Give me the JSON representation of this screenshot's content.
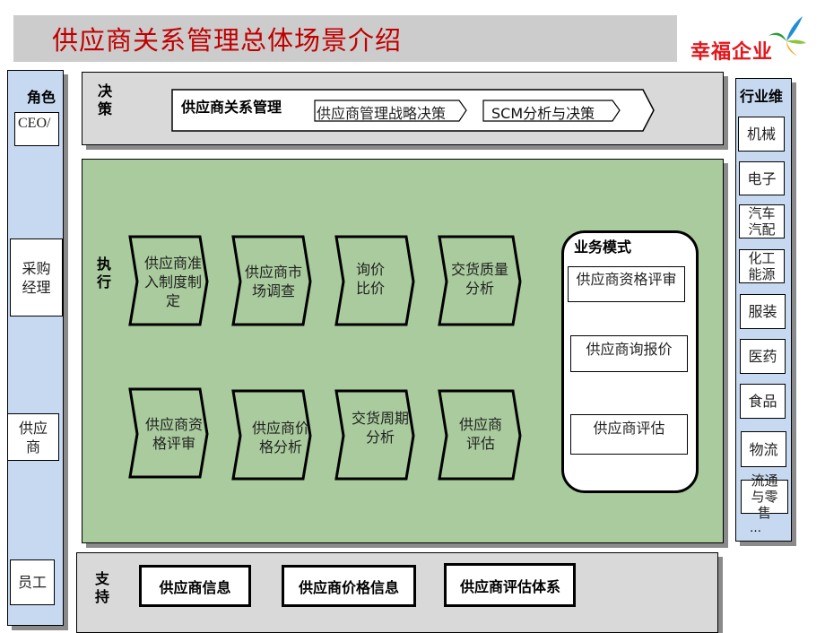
{
  "header": {
    "title": "供应商关系管理总体场景介绍",
    "logo_text": "幸福企业",
    "logo_icon": "pinwheel-icon"
  },
  "roles": {
    "heading": "角色",
    "items": [
      "CEO/",
      "采购经理",
      "供应商",
      "员工"
    ]
  },
  "industries": {
    "heading": "行业维",
    "items": [
      "机械",
      "电子",
      "汽车汽配",
      "化工能源",
      "服装",
      "医药",
      "食品",
      "物流",
      "流通与零售"
    ],
    "more": "…"
  },
  "decision": {
    "label": "决策",
    "main_arrow": "供应商关系管理",
    "steps": [
      "供应商管理战略决策",
      "SCM分析与决策"
    ]
  },
  "execution": {
    "label": "执行",
    "row1": [
      "供应商准入制度制定",
      "供应商市场调查",
      "询价比价",
      "交货质量分析"
    ],
    "row2": [
      "供应商资格评审",
      "供应商价格分析",
      "交货周期分析",
      "供应商评估"
    ],
    "business_mode": {
      "title": "业务模式",
      "items": [
        "供应商资格评审",
        "供应商询报价",
        "供应商评估"
      ]
    }
  },
  "support": {
    "label": "支持",
    "items": [
      "供应商信息",
      "供应商价格信息",
      "供应商评估体系"
    ]
  },
  "colors": {
    "title_red": "#c00000",
    "logo_red": "#e3161c",
    "role_blue": "#c6d9f1",
    "exec_green": "#a9cb9d",
    "panel_gray": "#d9d9d9"
  }
}
